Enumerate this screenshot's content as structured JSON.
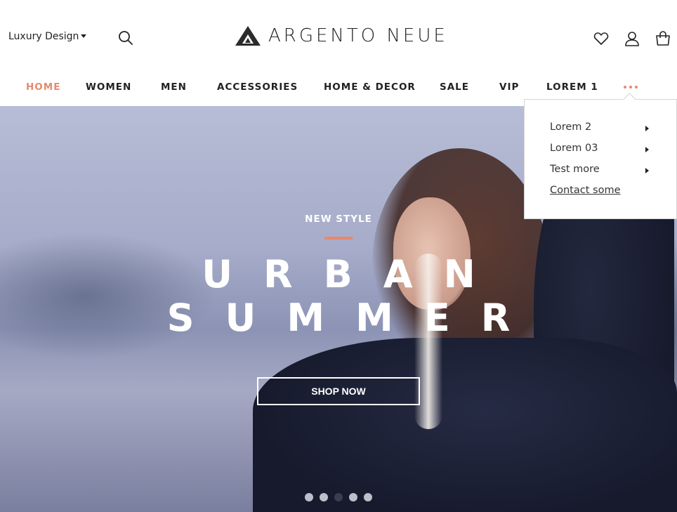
{
  "header": {
    "store_switcher": "Luxury Design",
    "logo_text": "ARGENTO NEUE",
    "icons": [
      "search-icon",
      "heart-icon",
      "user-icon",
      "bag-icon"
    ]
  },
  "nav": {
    "items": [
      {
        "label": "HOME",
        "active": true
      },
      {
        "label": "WOMEN"
      },
      {
        "label": "MEN"
      },
      {
        "label": "ACCESSORIES"
      },
      {
        "label": "HOME & DECOR"
      },
      {
        "label": "SALE"
      },
      {
        "label": "VIP"
      },
      {
        "label": "LOREM 1"
      }
    ],
    "more_icon": "more-dots-icon"
  },
  "dropdown": {
    "items": [
      {
        "label": "Lorem 2",
        "has_submenu": true
      },
      {
        "label": "Lorem 03",
        "has_submenu": true
      },
      {
        "label": "Test more",
        "has_submenu": true
      },
      {
        "label": "Contact some",
        "has_submenu": false
      }
    ]
  },
  "hero": {
    "subtitle": "NEW STYLE",
    "title_line1": "URBAN",
    "title_line2": "SUMMER",
    "button_label": "SHOP NOW",
    "slides_count": 5,
    "active_slide": 3
  },
  "colors": {
    "accent": "#e8896c",
    "text": "#222222"
  }
}
